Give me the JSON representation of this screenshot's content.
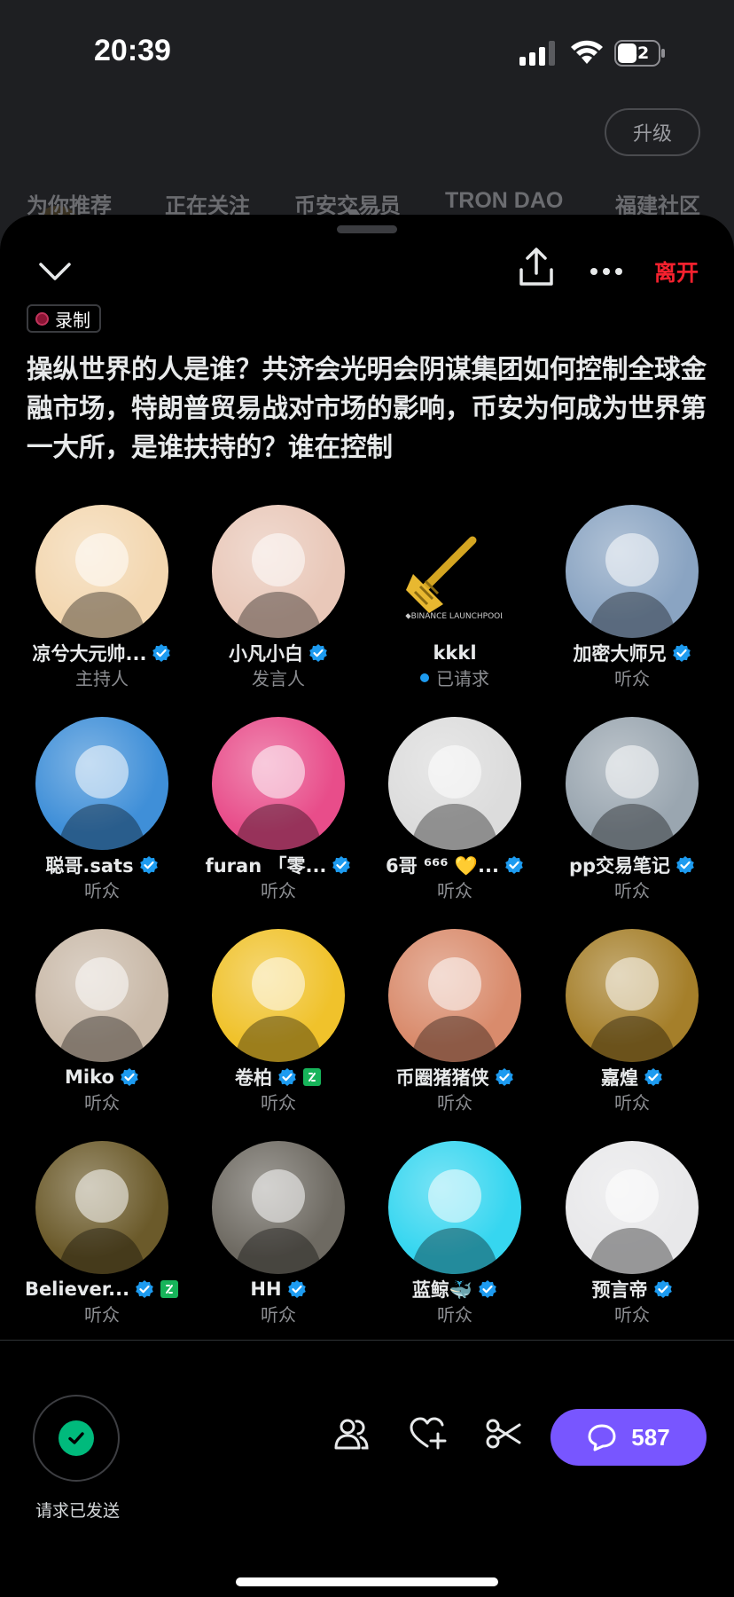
{
  "status_bar": {
    "time": "20:39",
    "battery": "42"
  },
  "background_app": {
    "upgrade_label": "升级",
    "tabs": [
      "为你推荐",
      "正在关注",
      "币安交易员",
      "TRON DAO",
      "福建社区"
    ]
  },
  "space": {
    "leave_label": "离开",
    "recording_label": "录制",
    "title": "操纵世界的人是谁？共济会光明会阴谋集团如何控制全球金融市场，特朗普贸易战对市场的影响，币安为何成为世界第一大所，是谁扶持的？谁在控制"
  },
  "participants": [
    {
      "name": "凉兮大元帅...",
      "role": "主持人",
      "verified": true,
      "avatar": "anime-girl-avatar",
      "color": "#f3d7b0"
    },
    {
      "name": "小凡小白",
      "role": "发言人",
      "verified": true,
      "avatar": "pink-penguin-avatar",
      "color": "#e9c8b9"
    },
    {
      "name": "kkkl",
      "role": "已请求",
      "verified": false,
      "requested": true,
      "avatar": "golden-spatula-avatar",
      "color": "#000000"
    },
    {
      "name": "加密大师兄",
      "role": "听众",
      "verified": true,
      "avatar": "toy-figure-avatar",
      "color": "#8aa4c2"
    },
    {
      "name": "聪哥.sats",
      "role": "听众",
      "verified": true,
      "avatar": "flame-hair-avatar",
      "color": "#3f8fd8"
    },
    {
      "name": "furan 「零...",
      "role": "听众",
      "verified": true,
      "avatar": "pink-hair-avatar",
      "color": "#e84d8a"
    },
    {
      "name": "6哥 ⁶⁶⁶ 💛...",
      "role": "听众",
      "verified": true,
      "avatar": "sketch-man-avatar",
      "color": "#dcdcdc"
    },
    {
      "name": "pp交易笔记",
      "role": "听众",
      "verified": true,
      "avatar": "orange-cat-avatar",
      "color": "#9aa6b0"
    },
    {
      "name": "Miko",
      "role": "听众",
      "verified": true,
      "avatar": "ferris-wheel-avatar",
      "color": "#c9b9a8"
    },
    {
      "name": "卷柏",
      "role": "听众",
      "verified": true,
      "extra_badge": true,
      "avatar": "btc-yellow-avatar",
      "color": "#f0c22b"
    },
    {
      "name": "币圈猪猪侠",
      "role": "听众",
      "verified": true,
      "avatar": "pig-hero-avatar",
      "color": "#d98b6c"
    },
    {
      "name": "嘉煌",
      "role": "听众",
      "verified": true,
      "avatar": "suit-man-avatar",
      "color": "#a57f2a"
    },
    {
      "name": "Believer...",
      "role": "听众",
      "verified": true,
      "extra_badge": true,
      "avatar": "gold-hood-avatar",
      "color": "#6b5a2a"
    },
    {
      "name": "HH",
      "role": "听众",
      "verified": true,
      "avatar": "street-photo-avatar",
      "color": "#6e6a62"
    },
    {
      "name": "蓝鲸🐳",
      "role": "听众",
      "verified": true,
      "avatar": "blue-whale-avatar",
      "color": "#36d6f0"
    },
    {
      "name": "预言帝",
      "role": "听众",
      "verified": true,
      "avatar": "white-hair-avatar",
      "color": "#e8e8ea"
    }
  ],
  "bottom": {
    "request_label": "请求已发送",
    "comments_count": "587"
  },
  "colors": {
    "accent": "#7856ff",
    "verified": "#1d9bf0",
    "leave": "#f4212e",
    "requested_check": "#00ba7c"
  }
}
